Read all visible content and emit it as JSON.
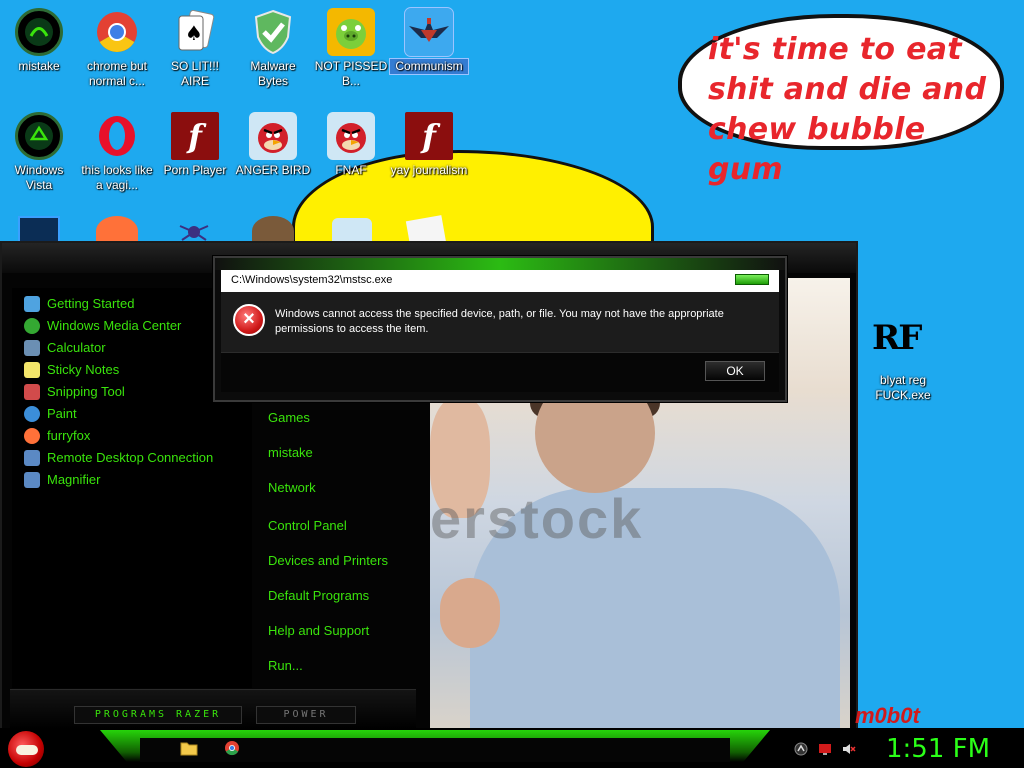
{
  "desktop": {
    "icons": [
      {
        "label": "mistake",
        "icon": "razer-icon",
        "color": "#0c4a25"
      },
      {
        "label": "chrome but normal c...",
        "icon": "chrome-icon",
        "color": "#e34133"
      },
      {
        "label": "SO LIT!!! AIRE",
        "icon": "solitaire-icon",
        "color": "#ffffff"
      },
      {
        "label": "Malware Bytes",
        "icon": "shield-check-icon",
        "color": "#3a9a3a"
      },
      {
        "label": "NOT PISSED B...",
        "icon": "bad-piggies-icon",
        "color": "#f4b800"
      },
      {
        "label": "Communism",
        "icon": "communism-icon",
        "color": "#c0392b"
      },
      {
        "label": "Windows Vista",
        "icon": "recycle-icon",
        "color": "#0c4a25"
      },
      {
        "label": "this looks like a vagi...",
        "icon": "opera-icon",
        "color": "#e8102a"
      },
      {
        "label": "Porn Player",
        "icon": "flash-icon",
        "color": "#8b0e0e"
      },
      {
        "label": "ANGER BIRD",
        "icon": "angry-bird-icon",
        "color": "#d2202a"
      },
      {
        "label": "FNAF",
        "icon": "angry-bird-icon",
        "color": "#d2202a"
      },
      {
        "label": "yay journalism",
        "icon": "flash-icon",
        "color": "#8b0e0e"
      },
      {
        "label": "blyat reg FUCK.exe",
        "icon": "rf-icon",
        "color": "#000000"
      }
    ],
    "bubble_text": "it's time to eat shit and die and chew bubble gum",
    "rf_mark": "RF",
    "watermark": "m0b0t"
  },
  "start_menu": {
    "left_items": [
      {
        "label": "Getting Started",
        "icon": "getting-started-icon",
        "color": "#4fa3e0"
      },
      {
        "label": "Windows Media Center",
        "icon": "media-center-icon",
        "color": "#34a832"
      },
      {
        "label": "Calculator",
        "icon": "calculator-icon",
        "color": "#6b8fb3"
      },
      {
        "label": "Sticky Notes",
        "icon": "sticky-notes-icon",
        "color": "#f3e56a"
      },
      {
        "label": "Snipping Tool",
        "icon": "snipping-tool-icon",
        "color": "#d14b4b"
      },
      {
        "label": "Paint",
        "icon": "paint-icon",
        "color": "#3b8ed9"
      },
      {
        "label": "furryfox",
        "icon": "firefox-icon",
        "color": "#ff7139"
      },
      {
        "label": "Remote Desktop Connection",
        "icon": "remote-desktop-icon",
        "color": "#5b89c4"
      },
      {
        "label": "Magnifier",
        "icon": "magnifier-icon",
        "color": "#5b89c4"
      }
    ],
    "right_items": [
      "Games",
      "mistake",
      "Network",
      "Control Panel",
      "Devices and Printers",
      "Default Programs",
      "Help and Support",
      "Run..."
    ],
    "programs_label": "PROGRAMS  RAZER",
    "power_label": "POWER",
    "photo_watermark": "erstock"
  },
  "dialog": {
    "title": "C:\\Windows\\system32\\mstsc.exe",
    "message": "Windows cannot access the specified device, path, or file.  You may not have the appropriate permissions to access the item.",
    "ok_label": "OK",
    "error_glyph": "×"
  },
  "taskbar": {
    "clock": "1:51 FM",
    "pinned": [
      {
        "icon": "folder-icon",
        "color": "#f3c94a"
      },
      {
        "icon": "chrome-icon",
        "color": "#e34133"
      }
    ],
    "tray": [
      {
        "icon": "razer-tray-icon",
        "color": "#888888"
      },
      {
        "icon": "action-center-icon",
        "color": "#d11b1b"
      },
      {
        "icon": "volume-muted-icon",
        "color": "#dddddd"
      }
    ]
  }
}
